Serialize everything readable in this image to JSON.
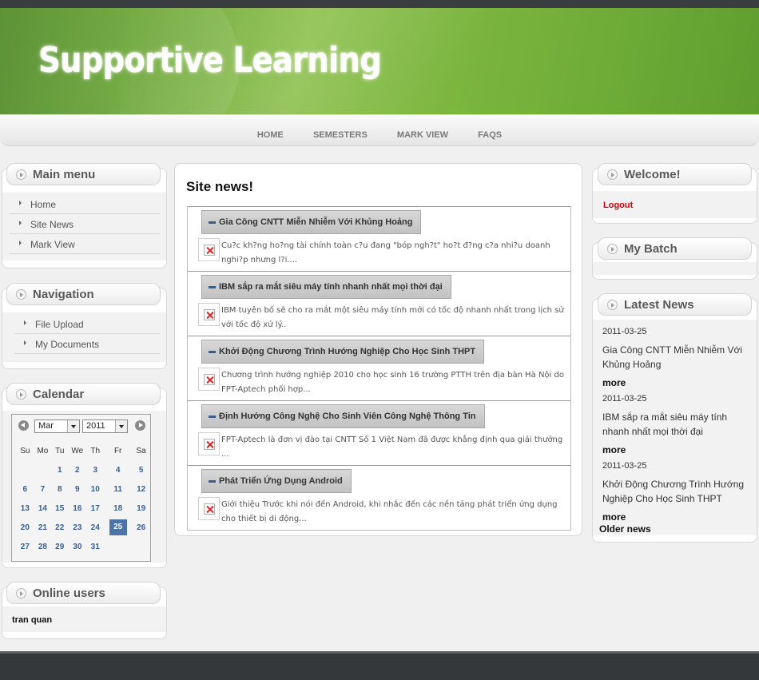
{
  "site": {
    "title": "Supportive Learning"
  },
  "nav": {
    "items": [
      "HOME",
      "SEMESTERS",
      "MARK VIEW",
      "FAQS"
    ]
  },
  "main_menu": {
    "title": "Main menu",
    "items": [
      "Home",
      "Site News",
      "Mark View"
    ]
  },
  "navigation": {
    "title": "Navigation",
    "items": [
      "File Upload",
      "My Documents"
    ]
  },
  "calendar": {
    "title": "Calendar",
    "month": "Mar",
    "year": "2011",
    "weekdays": [
      "Su",
      "Mo",
      "Tu",
      "We",
      "Th",
      "Fr",
      "Sa"
    ],
    "weeks": [
      [
        "",
        "",
        "1",
        "2",
        "3",
        "4",
        "5"
      ],
      [
        "6",
        "7",
        "8",
        "9",
        "10",
        "11",
        "12"
      ],
      [
        "13",
        "14",
        "15",
        "16",
        "17",
        "18",
        "19"
      ],
      [
        "20",
        "21",
        "22",
        "23",
        "24",
        "25",
        "26"
      ],
      [
        "27",
        "28",
        "29",
        "30",
        "31",
        "",
        ""
      ]
    ],
    "today": "25"
  },
  "online_users": {
    "title": "Online users",
    "users": [
      "tran quan"
    ]
  },
  "site_news": {
    "title": "Site news!",
    "items": [
      {
        "headline": "Gia Công CNTT Miễn Nhiễm Với Khủng Hoảng",
        "summary": "Cu?c kh?ng ho?ng tài chính toàn c?u đang \"bóp ngh?t\" ho?t đ?ng c?a nhi?u doanh nghi?p nhưng l?i...."
      },
      {
        "headline": "IBM sắp ra mắt siêu máy tính nhanh nhất mọi thời đại",
        "summary": "IBM tuyên bố sẽ cho ra mắt một siêu máy tính mới có tốc độ nhanh nhất trong lịch sử với tốc độ xử lý.."
      },
      {
        "headline": "Khởi Động Chương Trình Hướng Nghiệp Cho Học Sinh THPT",
        "summary": "Chương trình hướng nghiệp 2010 cho học sinh 16 trường PTTH trên địa bàn Hà Nội do FPT-Aptech phối hợp..."
      },
      {
        "headline": "Định Hướng Công Nghệ Cho Sinh Viên Công Nghệ Thông Tin",
        "summary": "FPT-Aptech là đơn vị đào tại CNTT Số 1 Việt Nam đã được khẳng định qua giải thưởng ..."
      },
      {
        "headline": "Phát Triển Ứng Dụng Android",
        "summary": "Giới thiệu Trước khi nói đến Android, khi nhắc đến các nền tảng phát triển ứng dụng cho thiết bị di động..."
      }
    ]
  },
  "welcome": {
    "title": "Welcome!",
    "logout": "Logout"
  },
  "my_batch": {
    "title": "My Batch"
  },
  "latest_news": {
    "title": "Latest News",
    "items": [
      {
        "date": "2011-03-25",
        "headline": "Gia Công CNTT Miễn Nhiễm Với Khủng Hoảng",
        "more": "more"
      },
      {
        "date": "2011-03-25",
        "headline": "IBM sắp ra mắt siêu máy tính nhanh nhất mọi thời đại",
        "more": "more"
      },
      {
        "date": "2011-03-25",
        "headline": "Khởi Động Chương Trình Hướng Nghiệp Cho Học Sinh THPT",
        "more": "more"
      }
    ],
    "older": "Older news"
  },
  "colors": {
    "banner_green": "#7ab53e",
    "logout_red": "#cc0000",
    "calendar_today": "#4c74a8"
  }
}
